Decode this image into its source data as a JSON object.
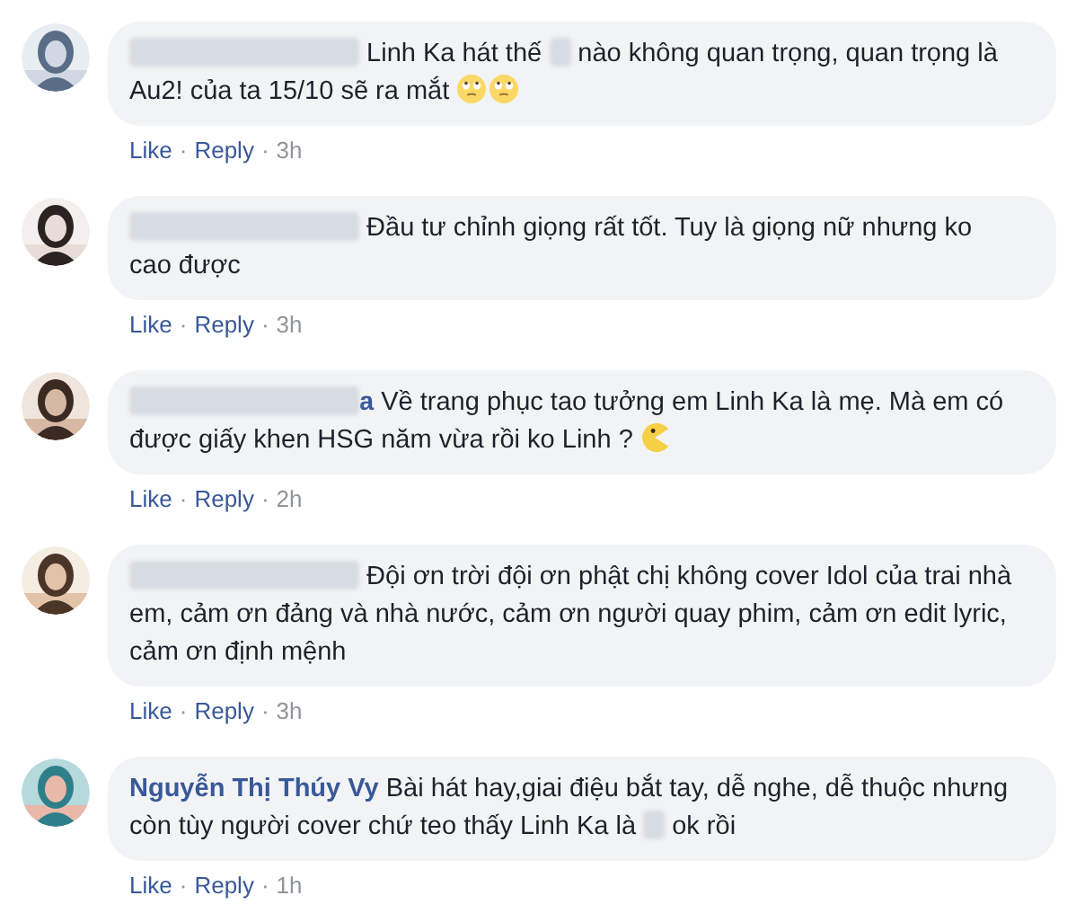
{
  "comments": [
    {
      "segments": [
        {
          "kind": "name_blur"
        },
        {
          "kind": "text",
          "text": " Linh Ka hát thế "
        },
        {
          "kind": "blur"
        },
        {
          "kind": "text",
          "text": " nào không quan trọng, quan trọng là Au2! của ta 15/10 sẽ ra mắt "
        },
        {
          "kind": "smiley"
        },
        {
          "kind": "smiley"
        }
      ],
      "action_line": [
        {
          "kind": "link",
          "text": "Like"
        },
        {
          "kind": "dot",
          "text": "·"
        },
        {
          "kind": "link",
          "text": "Reply"
        },
        {
          "kind": "dot",
          "text": "·"
        },
        {
          "kind": "time",
          "text": "3h"
        }
      ]
    },
    {
      "segments": [
        {
          "kind": "name_blur"
        },
        {
          "kind": "text",
          "text": " Đầu tư chỉnh giọng rất tốt. Tuy là giọng nữ nhưng ko cao được"
        }
      ],
      "action_line": [
        {
          "kind": "link",
          "text": "Like"
        },
        {
          "kind": "dot",
          "text": "·"
        },
        {
          "kind": "link",
          "text": "Reply"
        },
        {
          "kind": "dot",
          "text": "·"
        },
        {
          "kind": "time",
          "text": "3h"
        }
      ]
    },
    {
      "segments": [
        {
          "kind": "name_blur"
        },
        {
          "kind": "author",
          "text": "a"
        },
        {
          "kind": "text",
          "text": " Về trang phục tao tưởng em Linh Ka là mẹ. Mà em có được giấy khen HSG năm vừa rồi ko Linh ? "
        },
        {
          "kind": "pacman"
        }
      ],
      "action_line": [
        {
          "kind": "link",
          "text": "Like"
        },
        {
          "kind": "dot",
          "text": "·"
        },
        {
          "kind": "link",
          "text": "Reply"
        },
        {
          "kind": "dot",
          "text": "·"
        },
        {
          "kind": "time",
          "text": "2h"
        }
      ]
    },
    {
      "segments": [
        {
          "kind": "name_blur"
        },
        {
          "kind": "text",
          "text": " Đội ơn trời đội ơn phật chị không cover Idol của trai nhà em, cảm ơn đảng và nhà nước, cảm ơn người quay phim, cảm ơn edit lyric, cảm ơn định mệnh"
        }
      ],
      "action_line": [
        {
          "kind": "link",
          "text": "Like"
        },
        {
          "kind": "dot",
          "text": "·"
        },
        {
          "kind": "link",
          "text": "Reply"
        },
        {
          "kind": "dot",
          "text": "·"
        },
        {
          "kind": "time",
          "text": "3h"
        }
      ]
    },
    {
      "segments": [
        {
          "kind": "author",
          "text": "Nguyễn Thị Thúy Vy"
        },
        {
          "kind": "text",
          "text": " Bài hát hay,giai điệu bắt tay, dễ nghe, dễ thuộc nhưng còn tùy người cover chứ teo thấy Linh Ka là "
        },
        {
          "kind": "blur"
        },
        {
          "kind": "text",
          "text": " ok rồi"
        }
      ],
      "action_line": [
        {
          "kind": "link",
          "text": "Like"
        },
        {
          "kind": "dot",
          "text": "·"
        },
        {
          "kind": "link",
          "text": "Reply"
        },
        {
          "kind": "dot",
          "text": "·"
        },
        {
          "kind": "time",
          "text": "1h"
        }
      ]
    }
  ]
}
